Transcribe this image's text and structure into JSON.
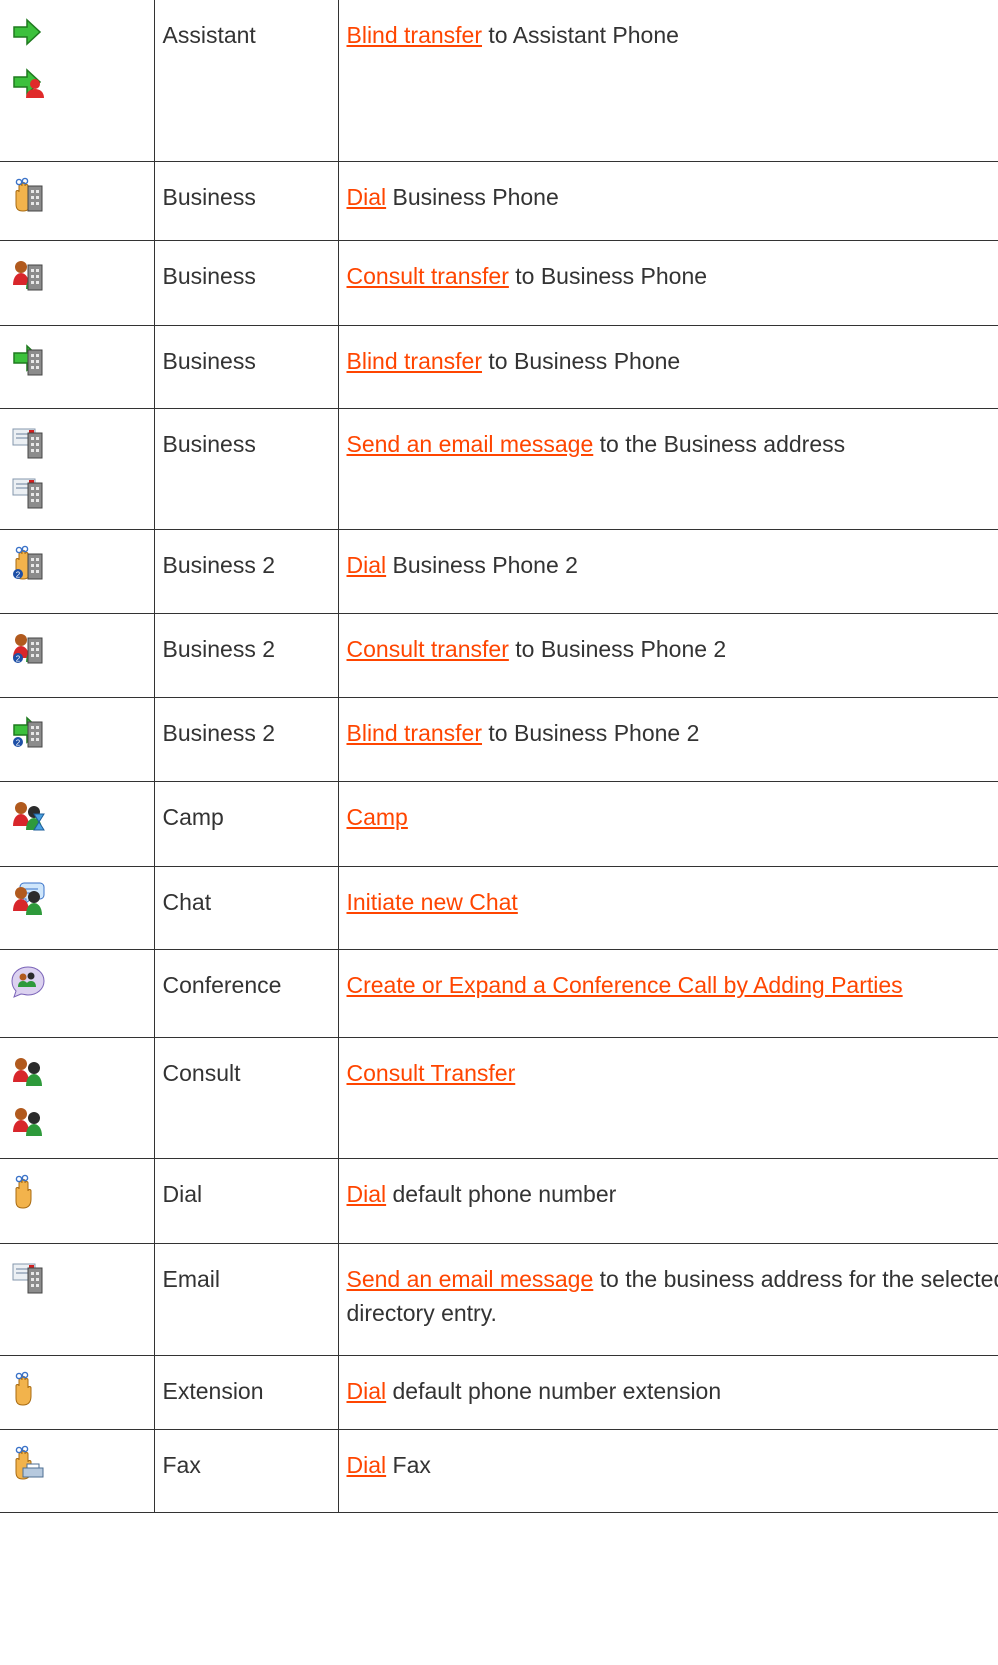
{
  "rows": [
    {
      "icons": [
        "green-arrow-icon",
        "arrow-person-icon"
      ],
      "label": "Assistant",
      "link": "Blind transfer",
      "rest": " to Assistant Phone"
    },
    {
      "icons": [
        "dial-building-icon"
      ],
      "label": "Business",
      "link": "Dial",
      "rest": " Business Phone"
    },
    {
      "icons": [
        "consult-building-icon"
      ],
      "label": "Business",
      "link": "Consult transfer",
      "rest": " to Business Phone"
    },
    {
      "icons": [
        "arrow-building-icon"
      ],
      "label": "Business",
      "link": "Blind transfer",
      "rest": " to Business Phone"
    },
    {
      "icons": [
        "email-building-icon",
        "email-card-icon"
      ],
      "label": "Business",
      "link": "Send an email message",
      "rest": " to the Business address"
    },
    {
      "icons": [
        "dial-building-2-icon"
      ],
      "label": "Business 2",
      "link": "Dial",
      "rest": " Business Phone 2"
    },
    {
      "icons": [
        "consult-building-2-icon"
      ],
      "label": "Business 2",
      "link": "Consult transfer",
      "rest": " to Business Phone 2"
    },
    {
      "icons": [
        "arrow-building-2-icon"
      ],
      "label": "Business 2",
      "link": "Blind transfer",
      "rest": " to Business Phone 2"
    },
    {
      "icons": [
        "camp-hourglass-icon"
      ],
      "label": "Camp",
      "link": "Camp",
      "rest": ""
    },
    {
      "icons": [
        "chat-people-icon"
      ],
      "label": "Chat",
      "link": "Initiate new Chat",
      "rest": ""
    },
    {
      "icons": [
        "conference-icon"
      ],
      "label": "Conference",
      "link": "Create or Expand a Conference Call by Adding Parties",
      "rest": ""
    },
    {
      "icons": [
        "consult-people-icon",
        "consult-person-icon"
      ],
      "label": "Consult",
      "link": "Consult Transfer",
      "rest": ""
    },
    {
      "icons": [
        "dial-hand-icon"
      ],
      "label": "Dial",
      "link": "Dial",
      "rest": " default phone number"
    },
    {
      "icons": [
        "email-building-icon"
      ],
      "label": "Email",
      "link": "Send an email message",
      "rest": " to the business address for the selected directory entry."
    },
    {
      "icons": [
        "dial-hand-icon"
      ],
      "label": "Extension",
      "link": "Dial",
      "rest": " default phone number extension"
    },
    {
      "icons": [
        "dial-fax-icon"
      ],
      "label": "Fax",
      "link": "Dial",
      "rest": " Fax"
    }
  ]
}
